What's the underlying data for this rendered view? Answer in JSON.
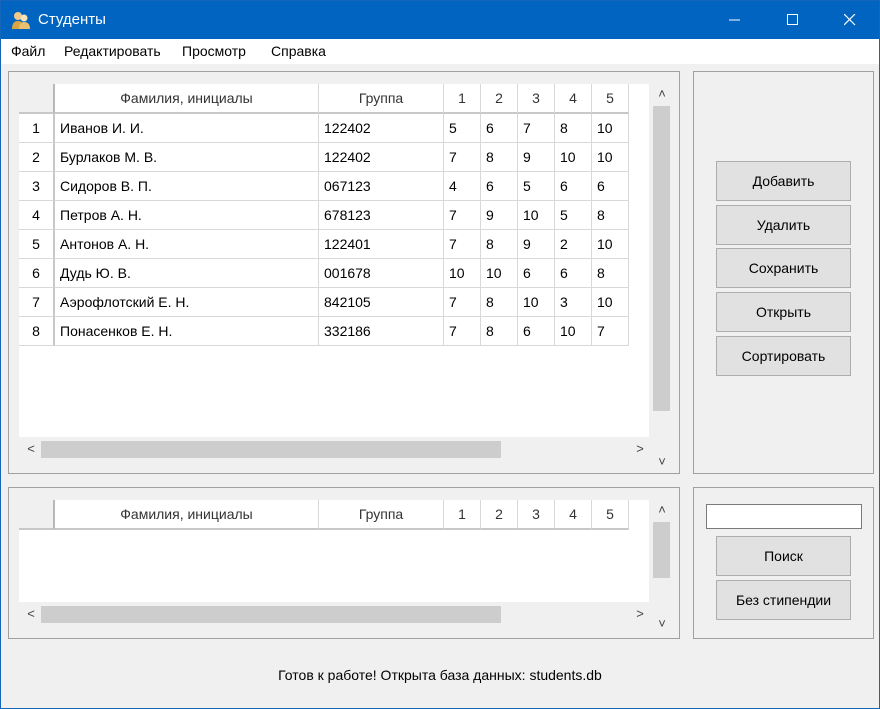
{
  "window": {
    "title": "Студенты",
    "controls": {
      "minimize": "–",
      "maximize": "☐",
      "close": "✕"
    }
  },
  "menu": [
    "Файл",
    "Редактировать",
    "Просмотр",
    "Справка"
  ],
  "columns": [
    "Фамилия, инициалы",
    "Группа",
    "1",
    "2",
    "3",
    "4",
    "5"
  ],
  "students": [
    {
      "num": "1",
      "name": "Иванов И. И.",
      "group": "122402",
      "g": [
        "5",
        "6",
        "7",
        "8",
        "10"
      ]
    },
    {
      "num": "2",
      "name": "Бурлаков М. В.",
      "group": "122402",
      "g": [
        "7",
        "8",
        "9",
        "10",
        "10"
      ]
    },
    {
      "num": "3",
      "name": "Сидоров В. П.",
      "group": "067123",
      "g": [
        "4",
        "6",
        "5",
        "6",
        "6"
      ]
    },
    {
      "num": "4",
      "name": "Петров А. Н.",
      "group": "678123",
      "g": [
        "7",
        "9",
        "10",
        "5",
        "8"
      ]
    },
    {
      "num": "5",
      "name": "Антонов А. Н.",
      "group": "122401",
      "g": [
        "7",
        "8",
        "9",
        "2",
        "10"
      ]
    },
    {
      "num": "6",
      "name": "Дудь Ю. В.",
      "group": "001678",
      "g": [
        "10",
        "10",
        "6",
        "6",
        "8"
      ]
    },
    {
      "num": "7",
      "name": "Аэрофлотский Е. Н.",
      "group": "842105",
      "g": [
        "7",
        "8",
        "10",
        "3",
        "10"
      ]
    },
    {
      "num": "8",
      "name": "Понасенков Е. Н.",
      "group": "332186",
      "g": [
        "7",
        "8",
        "6",
        "10",
        "7"
      ]
    }
  ],
  "buttons": {
    "add": "Добавить",
    "delete": "Удалить",
    "save": "Сохранить",
    "open": "Открыть",
    "sort": "Сортировать",
    "search": "Поиск",
    "no_scholarship": "Без стипендии"
  },
  "search": {
    "value": ""
  },
  "scroll_arrows": {
    "up": "˄",
    "down": "˅",
    "left": "<",
    "right": ">"
  },
  "status": "Готов к работе! Открыта база данных: students.db",
  "colors": {
    "titlebar": "#0064c0",
    "window_bg": "#f0f0f0",
    "button_bg": "#e1e1e1"
  },
  "icons": {
    "app": "users-icon"
  }
}
